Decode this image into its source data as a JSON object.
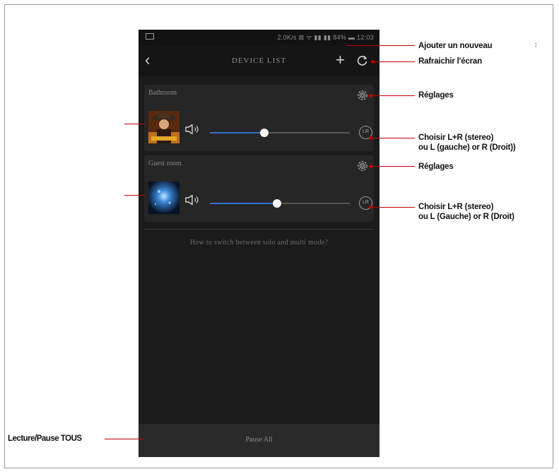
{
  "status_bar": {
    "text": "2.0K/s ⊠ ᯤ ▮▮ ▮▮ 84% ▬ 12:03"
  },
  "top_bar": {
    "title": "DEVICE LIST",
    "back_icon": "chevron-left-icon",
    "add_icon": "plus-icon",
    "refresh_icon": "refresh-icon"
  },
  "devices": [
    {
      "name": "Bathroom",
      "volume_fraction": 0.39,
      "channel_label": "LR"
    },
    {
      "name": "Guest room",
      "volume_fraction": 0.48,
      "channel_label": "LR"
    }
  ],
  "help_link": "How to switch between solo and multi mode?",
  "bottom_bar": {
    "pause_all_label": "Pause All"
  },
  "callouts": {
    "add_new": "Ajouter un nouveau",
    "refresh": "Rafraichir l'écran",
    "settings_1": "Réglages",
    "channel_1_line1": "Choisir L+R (stereo)",
    "channel_1_line2": "ou L (gauche) or R (Droit))",
    "settings_2": "Réglages",
    "channel_2_line1": "Choisir L+R (stereo)",
    "channel_2_line2": "ou L (Gauche) or R (Droit)",
    "play_pause_all": "Lecture/Pause TOUS"
  },
  "colors": {
    "accent": "#2f72c4",
    "callout_line": "#c00000",
    "screen_bg": "#1b1b1b",
    "card_bg": "#262626"
  }
}
